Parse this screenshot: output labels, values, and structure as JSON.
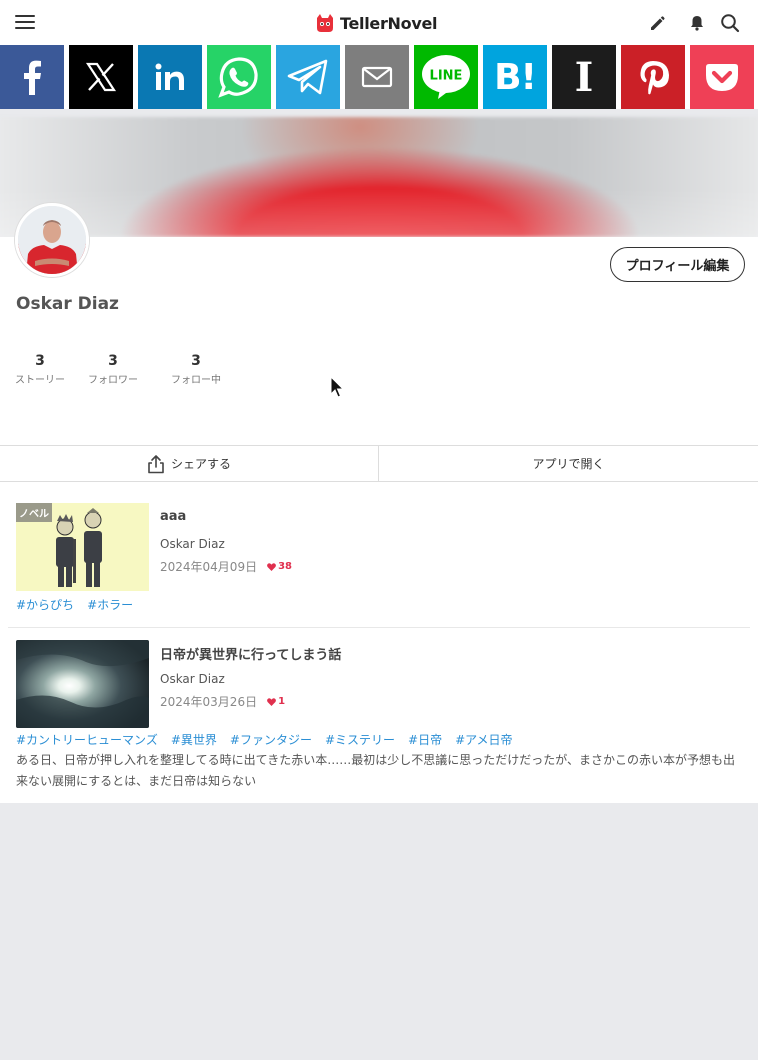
{
  "header": {
    "logo_text": "TellerNovel",
    "icons": [
      "hamburger-menu-icon",
      "pencil-icon",
      "bell-icon",
      "search-icon"
    ]
  },
  "share_bar": {
    "buttons": [
      {
        "name": "facebook",
        "label": "f",
        "color": "#3b5998"
      },
      {
        "name": "x",
        "label": "X",
        "color": "#000000"
      },
      {
        "name": "linkedin",
        "label": "in",
        "color": "#0a78b3"
      },
      {
        "name": "whatsapp",
        "label": "",
        "color": "#26d367"
      },
      {
        "name": "telegram",
        "label": "",
        "color": "#2aa5e0"
      },
      {
        "name": "email",
        "label": "",
        "color": "#7e7e7e"
      },
      {
        "name": "line",
        "label": "LINE",
        "color": "#00b900"
      },
      {
        "name": "hatena",
        "label": "B!",
        "color": "#00a4de"
      },
      {
        "name": "instapaper",
        "label": "I",
        "color": "#1c1c1c"
      },
      {
        "name": "pinterest",
        "label": "",
        "color": "#cb2027"
      },
      {
        "name": "pocket",
        "label": "",
        "color": "#ef4056"
      }
    ]
  },
  "profile": {
    "name": "Oskar Diaz",
    "edit_button": "プロフィール編集",
    "stats": [
      {
        "value": "3",
        "label": "ストーリー"
      },
      {
        "value": "3",
        "label": "フォロワー"
      },
      {
        "value": "3",
        "label": "フォロー中"
      }
    ]
  },
  "actions": {
    "share": "シェアする",
    "open_app": "アプリで開く"
  },
  "stories": [
    {
      "badge": "ノベル",
      "title": "aaa",
      "author": "Oskar Diaz",
      "date": "2024年04月09日",
      "likes": "38",
      "tags": [
        "#からぴち",
        "#ホラー"
      ],
      "description": ""
    },
    {
      "badge": "",
      "title": "日帝が異世界に行ってしまう話",
      "author": "Oskar Diaz",
      "date": "2024年03月26日",
      "likes": "1",
      "tags": [
        "#カントリーヒューマンズ",
        "#異世界",
        "#ファンタジー",
        "#ミステリー",
        "#日帝",
        "#アメ日帝"
      ],
      "description": "ある日、日帝が押し入れを整理してる時に出てきた赤い本……最初は少し不思議に思っただけだったが、まさかこの赤い本が予想も出来ない展開にするとは、まだ日帝は知らない"
    }
  ],
  "colors": {
    "tag": "#2a8ed4",
    "like": "#e0304e",
    "page_bg": "#e9eaed"
  }
}
